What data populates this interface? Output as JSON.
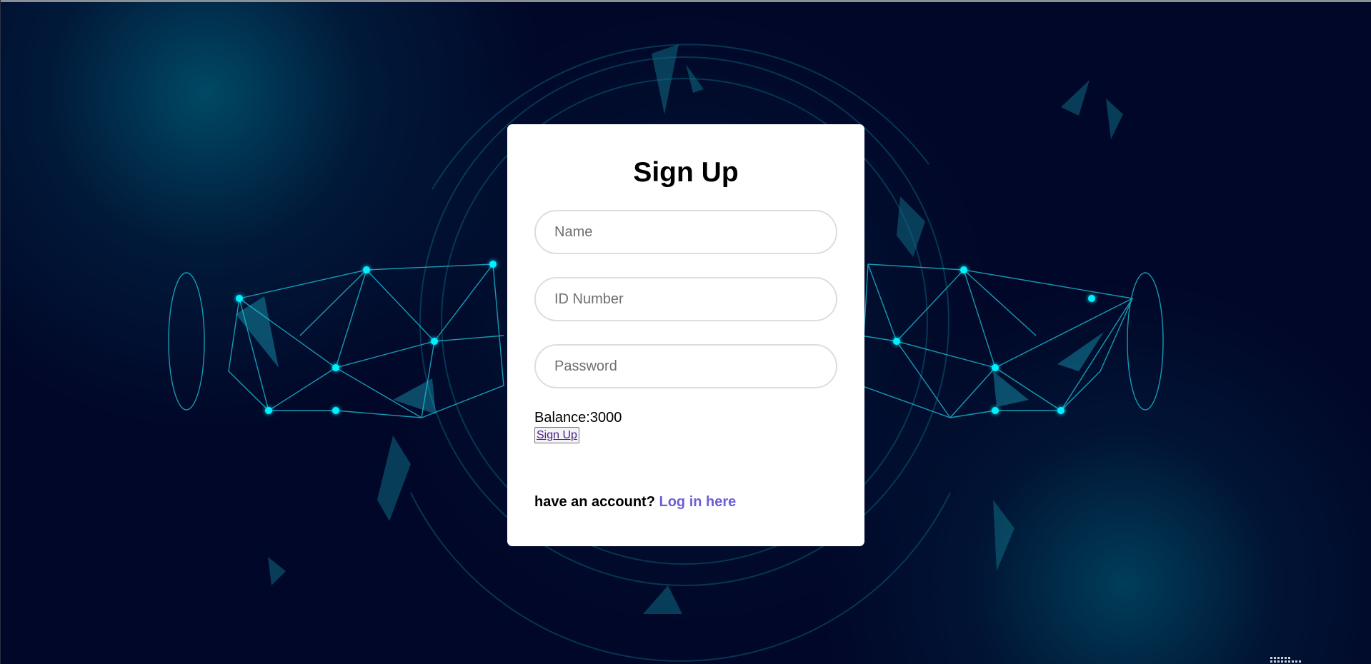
{
  "form": {
    "title": "Sign Up",
    "name_placeholder": "Name",
    "id_placeholder": "ID Number",
    "password_placeholder": "Password",
    "balance_text": "Balance:3000",
    "submit_label": "Sign Up",
    "account_prompt": "have an account?",
    "login_link_label": "Log in here"
  },
  "colors": {
    "background": "#010728",
    "accent_cyan": "#00e5ff",
    "link": "#6a5fd8",
    "card": "#ffffff"
  }
}
